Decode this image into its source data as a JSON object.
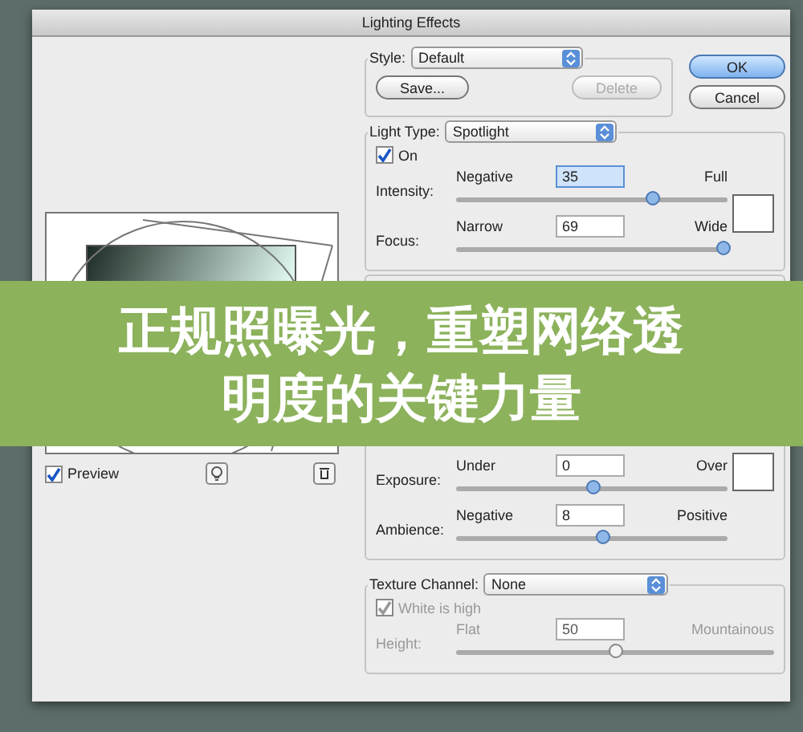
{
  "window": {
    "title": "Lighting Effects"
  },
  "style_group": {
    "label": "Style:",
    "value": "Default",
    "buttons": [
      {
        "label": "Save...",
        "disabled": false
      },
      {
        "label": "Delete",
        "disabled": true
      }
    ]
  },
  "dialog_buttons": [
    {
      "label": "OK",
      "default": true
    },
    {
      "label": "Cancel",
      "default": false
    }
  ],
  "preview": {
    "label": "Preview",
    "checked": true
  },
  "light_type": {
    "label": "Light Type:",
    "value": "Spotlight",
    "on": {
      "label": "On",
      "checked": true
    },
    "sliders": [
      {
        "label": "Intensity:",
        "min_label": "Negative",
        "value": "35",
        "max_label": "Full",
        "level": 0.72,
        "focused": true
      },
      {
        "label": "Focus:",
        "min_label": "Narrow",
        "value": "69",
        "max_label": "Wide",
        "level": 0.98,
        "focused": false
      }
    ]
  },
  "properties": {
    "sliders": [
      {
        "label": "Exposure:",
        "min_label": "Under",
        "value": "0",
        "max_label": "Over",
        "level": 0.5,
        "focused": false
      },
      {
        "label": "Ambience:",
        "min_label": "Negative",
        "value": "8",
        "max_label": "Positive",
        "level": 0.54,
        "focused": false
      }
    ]
  },
  "texture": {
    "label": "Texture Channel:",
    "value": "None",
    "white_is_high": {
      "label": "White is high",
      "checked": true,
      "disabled": true
    },
    "sliders": [
      {
        "label": "Height:",
        "min_label": "Flat",
        "value": "50",
        "max_label": "Mountainous",
        "level": 0.5,
        "focused": false,
        "disabled": true
      }
    ]
  },
  "banner": {
    "text": "正规照曝光，重塑网络透明度的关键力量"
  }
}
